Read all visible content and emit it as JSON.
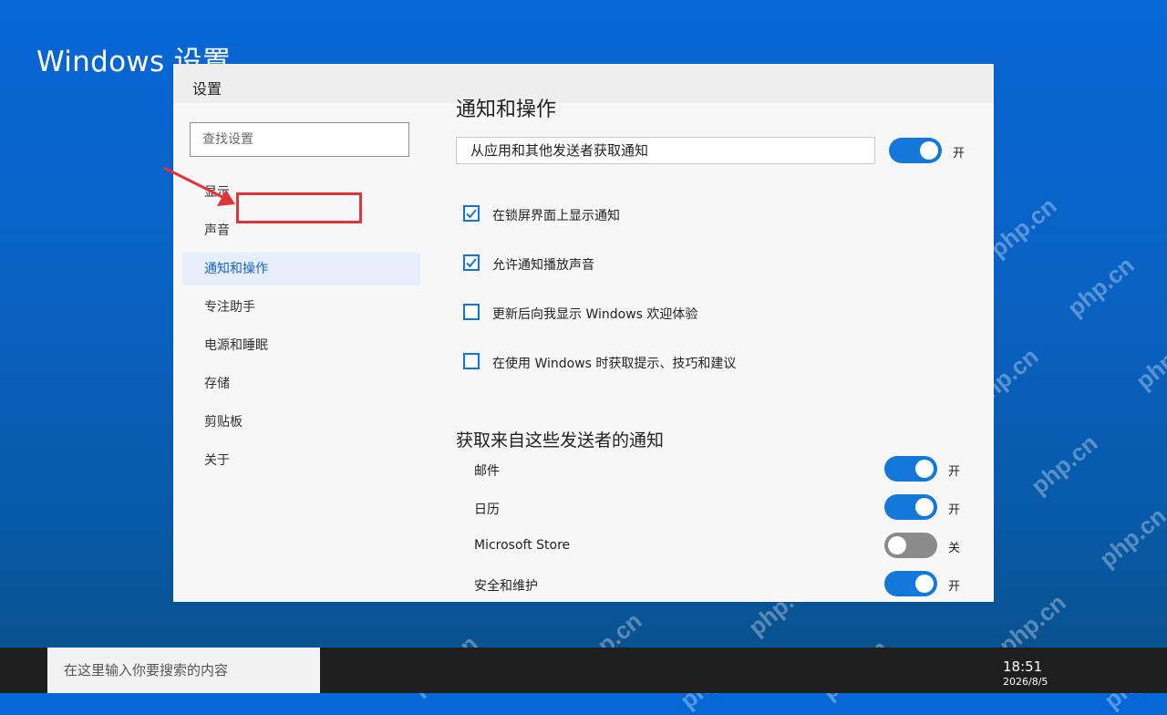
{
  "desktop": {
    "title": "Windows 设置",
    "watermark": "php.cn"
  },
  "window": {
    "title": "设置"
  },
  "sidebar": {
    "search_placeholder": "查找设置",
    "items": [
      {
        "label": "显示"
      },
      {
        "label": "声音"
      },
      {
        "label": "通知和操作",
        "active": true
      },
      {
        "label": "专注助手"
      },
      {
        "label": "电源和睡眠"
      },
      {
        "label": "存储"
      },
      {
        "label": "剪贴板"
      },
      {
        "label": "关于"
      }
    ]
  },
  "main": {
    "heading": "通知和操作",
    "master_toggle": {
      "label": "从应用和其他发送者获取通知",
      "state": "开",
      "on": true
    },
    "checkboxes": [
      {
        "label": "在锁屏界面上显示通知",
        "checked": true
      },
      {
        "label": "允许通知播放声音",
        "checked": true
      },
      {
        "label": "更新后向我显示 Windows 欢迎体验",
        "checked": false
      },
      {
        "label": "在使用 Windows 时获取提示、技巧和建议",
        "checked": false
      }
    ],
    "senders_heading": "获取来自这些发送者的通知",
    "senders": [
      {
        "name": "邮件",
        "state": "开",
        "on": true
      },
      {
        "name": "日历",
        "state": "开",
        "on": true
      },
      {
        "name": "Microsoft Store",
        "state": "关",
        "on": false
      },
      {
        "name": "安全和维护",
        "state": "开",
        "on": true
      }
    ]
  },
  "taskbar": {
    "search_placeholder": "在这里输入你要搜索的内容",
    "time": "18:51",
    "date": "2026/8/5"
  },
  "colors": {
    "accent": "#1378d9",
    "toggle_off": "#8a8a8a",
    "annotation": "#e0333a",
    "active_nav_bg": "#e5eefa"
  },
  "icons": {
    "checkmark": "check-icon",
    "annotation_arrow": "arrow-icon"
  }
}
